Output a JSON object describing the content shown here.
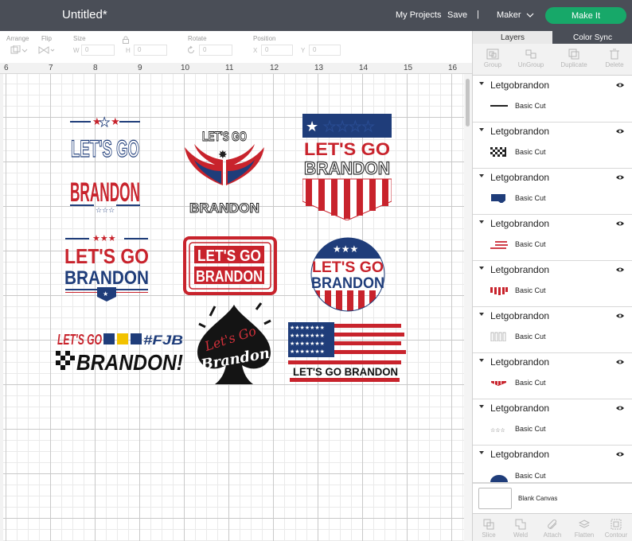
{
  "header": {
    "title": "Untitled*",
    "my_projects": "My Projects",
    "save": "Save",
    "separator": "|",
    "machine": "Maker",
    "make_it": "Make It"
  },
  "toolbar": {
    "arrange": "Arrange",
    "flip": "Flip",
    "size": "Size",
    "w": "W",
    "h": "H",
    "rotate": "Rotate",
    "position": "Position",
    "x": "X",
    "y": "Y",
    "zero": "0"
  },
  "ruler": {
    "numbers": [
      "6",
      "7",
      "8",
      "9",
      "10",
      "11",
      "12",
      "13",
      "14",
      "15",
      "16"
    ]
  },
  "canvas": {
    "designs": [
      {
        "name": "lets-go-brandon-stars-vertical",
        "lines": [
          "LET'S GO",
          "BRANDON"
        ]
      },
      {
        "name": "lets-go-brandon-wings",
        "lines": [
          "LET'S GO",
          "BRANDON"
        ]
      },
      {
        "name": "lets-go-brandon-shield",
        "lines": [
          "LET'S GO",
          "BRANDON"
        ]
      },
      {
        "name": "lets-go-brandon-banner",
        "lines": [
          "LET'S GO",
          "BRANDON"
        ]
      },
      {
        "name": "lets-go-brandon-stamp",
        "lines": [
          "LET'S GO",
          "BRANDON"
        ]
      },
      {
        "name": "lets-go-brandon-circle",
        "lines": [
          "LET'S GO",
          "BRANDON"
        ]
      },
      {
        "name": "lets-go-brandon-racing",
        "lines": [
          "LET'S GO",
          "#FJB",
          "BRANDON!"
        ]
      },
      {
        "name": "lets-go-brandon-spade",
        "lines": [
          "Let's Go",
          "Brandon"
        ]
      },
      {
        "name": "lets-go-brandon-flag",
        "lines": [
          "LET'S GO BRANDON"
        ]
      }
    ]
  },
  "panel": {
    "tabs": [
      "Layers",
      "Color Sync"
    ],
    "actions": [
      "Group",
      "UnGroup",
      "Duplicate",
      "Delete"
    ],
    "layers": [
      {
        "name": "Letgobrandon",
        "sub": "Basic Cut",
        "thumb": "text-thumb"
      },
      {
        "name": "Letgobrandon",
        "sub": "Basic Cut",
        "thumb": "checker-thumb"
      },
      {
        "name": "Letgobrandon",
        "sub": "Basic Cut",
        "thumb": "blue-shape-thumb"
      },
      {
        "name": "Letgobrandon",
        "sub": "Basic Cut",
        "thumb": "flag-thumb"
      },
      {
        "name": "Letgobrandon",
        "sub": "Basic Cut",
        "thumb": "red-stripes-thumb"
      },
      {
        "name": "Letgobrandon",
        "sub": "Basic Cut",
        "thumb": "outline-thumb"
      },
      {
        "name": "Letgobrandon",
        "sub": "Basic Cut",
        "thumb": "red-shape-thumb"
      },
      {
        "name": "Letgobrandon",
        "sub": "Basic Cut",
        "thumb": "stars-thumb"
      },
      {
        "name": "Letgobrandon",
        "sub": "Basic Cut",
        "thumb": "blue-arc-thumb"
      }
    ],
    "blank_canvas": "Blank Canvas",
    "footer": [
      "Slice",
      "Weld",
      "Attach",
      "Flatten",
      "Contour"
    ]
  },
  "colors": {
    "topbar": "#4a4e57",
    "make_it": "#17a869",
    "red": "#c8232c",
    "blue": "#1f3d7a"
  }
}
